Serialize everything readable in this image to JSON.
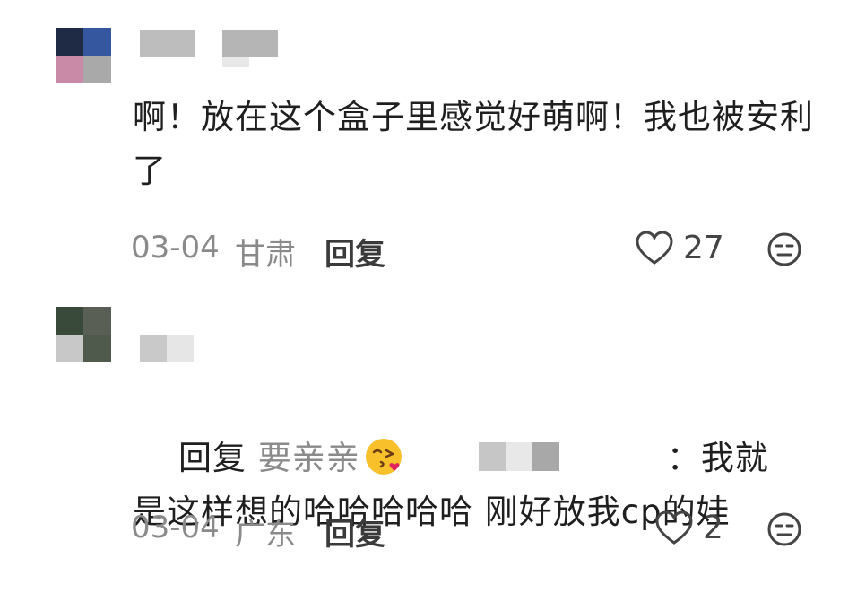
{
  "comments": [
    {
      "text": "啊！放在这个盒子里感觉好萌啊！我也被安利了",
      "date": "03-04",
      "region": "甘肃",
      "reply_label": "回复",
      "likes": "27",
      "avatar_colors": [
        "#1f2a45",
        "#3557a0",
        "#c98aa8",
        "#a9a9a9"
      ]
    },
    {
      "reply_prefix": "回复",
      "reply_to": "要亲亲",
      "reply_to_emoji": "kissing-wink-emoji",
      "separator": "：",
      "text_line1": "我就",
      "text_line2": "是这样想的哈哈哈哈哈 刚好放我cp的娃",
      "date": "03-04",
      "region": "广东",
      "reply_label": "回复",
      "likes": "2",
      "avatar_colors": [
        "#3a4a3a",
        "#5a5f55",
        "#c8c8c8",
        "#4f5a4c"
      ]
    }
  ],
  "icons": {
    "like": "heart-outline-icon",
    "emoji": "expressionless-face-icon"
  }
}
